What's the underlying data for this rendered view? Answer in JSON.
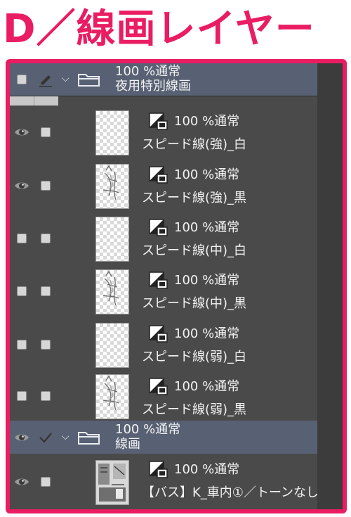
{
  "title": "D／線画レイヤー",
  "colors": {
    "accent": "#ea1c62",
    "panel_bg": "#4a4a4a",
    "folder_bg": "#586173",
    "column_bg": "#c8c8c8"
  },
  "rows": [
    {
      "type": "folder",
      "blend": "100 %通常",
      "name": "夜用特別線画",
      "visible": false,
      "edit": "pen-icon"
    },
    {
      "type": "layer",
      "blend": "100 %通常",
      "name": "スピード線(強)_白",
      "visible": true,
      "edit": "checkbox",
      "thumb": "checker"
    },
    {
      "type": "layer",
      "blend": "100 %通常",
      "name": "スピード線(強)_黒",
      "visible": true,
      "edit": "checkbox",
      "thumb": "sketch"
    },
    {
      "type": "layer",
      "blend": "100 %通常",
      "name": "スピード線(中)_白",
      "visible": false,
      "edit": "checkbox",
      "thumb": "checker"
    },
    {
      "type": "layer",
      "blend": "100 %通常",
      "name": "スピード線(中)_黒",
      "visible": false,
      "edit": "checkbox",
      "thumb": "sketch"
    },
    {
      "type": "layer",
      "blend": "100 %通常",
      "name": "スピード線(弱)_白",
      "visible": false,
      "edit": "checkbox",
      "thumb": "checker"
    },
    {
      "type": "layer",
      "blend": "100 %通常",
      "name": "スピード線(弱)_黒",
      "visible": false,
      "edit": "checkbox",
      "thumb": "sketch"
    },
    {
      "type": "folder",
      "blend": "100 %通常",
      "name": "線画",
      "visible": true,
      "edit": "check-icon"
    },
    {
      "type": "layer",
      "blend": "100 %通常",
      "name": "【バス】K_車内①／トーンなし",
      "visible": true,
      "edit": "checkbox",
      "thumb": "photo"
    }
  ]
}
